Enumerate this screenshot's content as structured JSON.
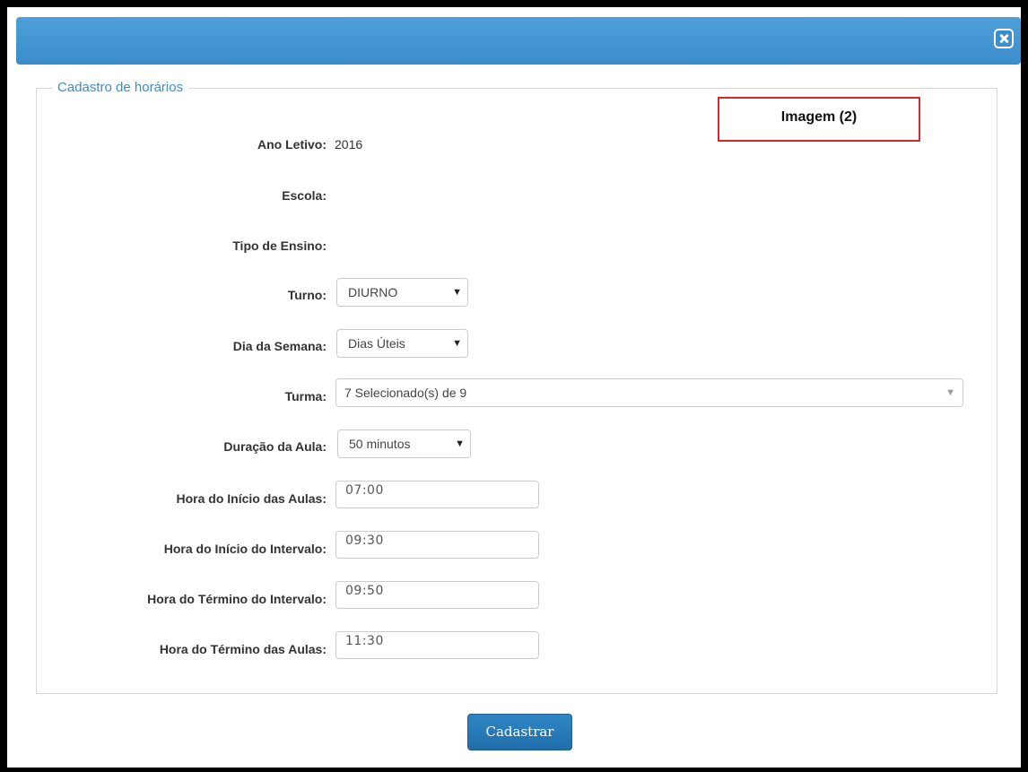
{
  "dialog": {
    "close_icon": "close-icon"
  },
  "form": {
    "legend": "Cadastro de horários",
    "annotation": "Imagem (2)",
    "ano_letivo": {
      "label": "Ano Letivo:",
      "value": "2016"
    },
    "escola": {
      "label": "Escola:"
    },
    "tipo_ensino": {
      "label": "Tipo de Ensino:"
    },
    "turno": {
      "label": "Turno:",
      "value": "DIURNO"
    },
    "dia_semana": {
      "label": "Dia da Semana:",
      "value": "Dias Úteis"
    },
    "turma": {
      "label": "Turma:",
      "value": "7 Selecionado(s) de 9"
    },
    "duracao": {
      "label": "Duração da Aula:",
      "value": "50 minutos"
    },
    "hora_inicio_aulas": {
      "label": "Hora do Início das Aulas:",
      "value": "07:00"
    },
    "hora_inicio_intervalo": {
      "label": "Hora do Início do Intervalo:",
      "value": "09:30"
    },
    "hora_termino_intervalo": {
      "label": "Hora do Término do Intervalo:",
      "value": "09:50"
    },
    "hora_termino_aulas": {
      "label": "Hora do Término das Aulas:",
      "value": "11:30"
    },
    "submit_label": "Cadastrar"
  },
  "colors": {
    "titlebar": "#3e8dcb",
    "legend": "#3d8ccb",
    "annotation_border": "#d9262e",
    "button": "#2576b6"
  }
}
